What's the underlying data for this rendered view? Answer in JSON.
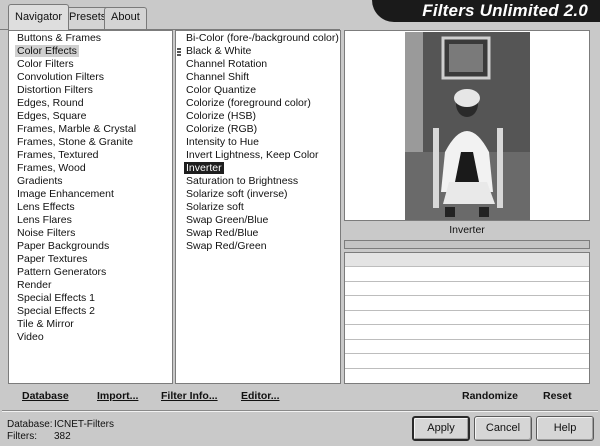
{
  "app": {
    "title": "Filters Unlimited 2.0"
  },
  "tabs": [
    {
      "label": "Navigator",
      "active": true
    },
    {
      "label": "Presets",
      "active": false
    },
    {
      "label": "About",
      "active": false
    }
  ],
  "categories": {
    "selected": "Color Effects",
    "items": [
      "Buttons & Frames",
      "Color Effects",
      "Color Filters",
      "Convolution Filters",
      "Distortion Filters",
      "Edges, Round",
      "Edges, Square",
      "Frames, Marble & Crystal",
      "Frames, Stone & Granite",
      "Frames, Textured",
      "Frames, Wood",
      "Gradients",
      "Image Enhancement",
      "Lens Effects",
      "Lens Flares",
      "Noise Filters",
      "Paper Backgrounds",
      "Paper Textures",
      "Pattern Generators",
      "Render",
      "Special Effects 1",
      "Special Effects 2",
      "Tile & Mirror",
      "Video"
    ]
  },
  "filters": {
    "selected": "Inverter",
    "items": [
      "Bi-Color (fore-/background color)",
      "Black & White",
      "Channel Rotation",
      "Channel Shift",
      "Color Quantize",
      "Colorize (foreground color)",
      "Colorize (HSB)",
      "Colorize (RGB)",
      "Intensity to Hue",
      "Invert Lightness, Keep Color",
      "Inverter",
      "Saturation to Brightness",
      "Solarize soft (inverse)",
      "Solarize soft",
      "Swap Green/Blue",
      "Swap Red/Blue",
      "Swap Red/Green"
    ]
  },
  "preview": {
    "filter_name": "Inverter",
    "progress": 0
  },
  "toolbar": {
    "database": "Database",
    "import": "Import...",
    "filter_info": "Filter Info...",
    "editor": "Editor...",
    "randomize": "Randomize",
    "reset": "Reset"
  },
  "status": {
    "database_label": "Database:",
    "database_value": "ICNET-Filters",
    "filters_label": "Filters:",
    "filters_value": "382"
  },
  "buttons": {
    "apply": "Apply",
    "cancel": "Cancel",
    "help": "Help"
  },
  "colors": {
    "banner_bg": "#1a1a1a",
    "selection_dark": "#1e1e1e",
    "selection_light": "#d0d0d0"
  }
}
